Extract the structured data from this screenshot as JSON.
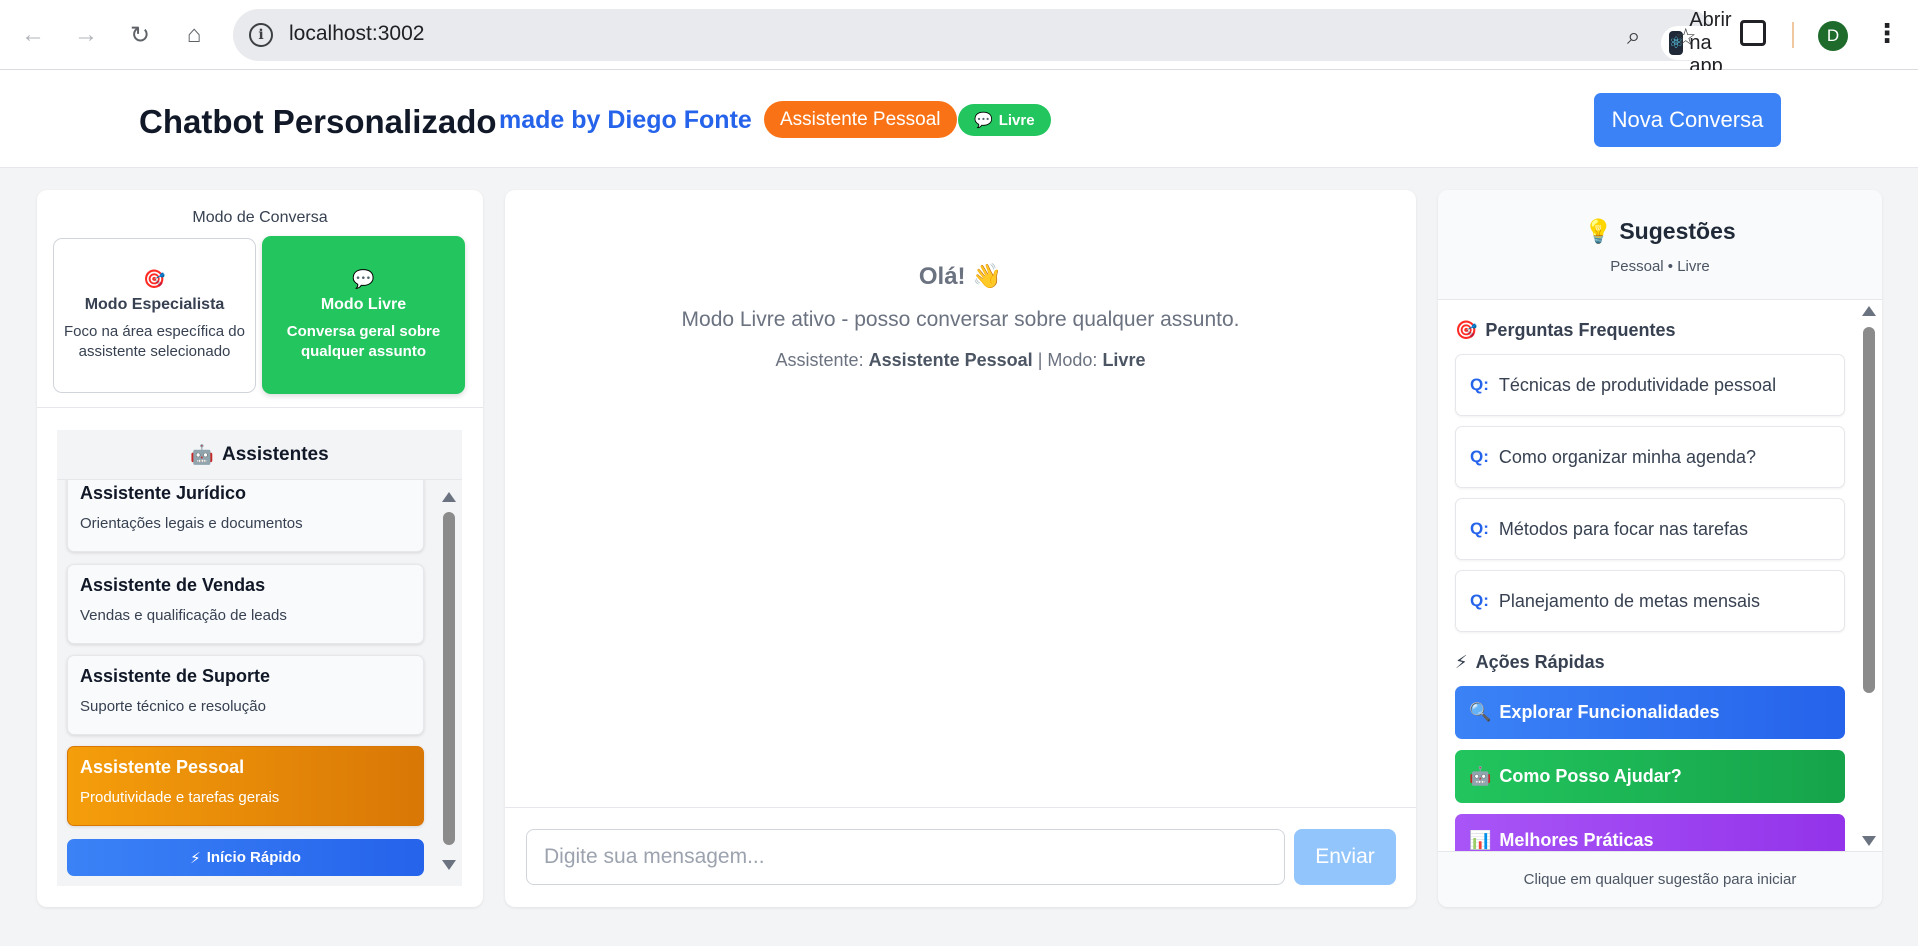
{
  "browser": {
    "url": "localhost:3002",
    "open_app_label": "Abrir na app",
    "profile_initial": "D"
  },
  "header": {
    "title": "Chatbot Personalizado",
    "made_by": "made by Diego Fonte",
    "assistant_badge": "Assistente Pessoal",
    "mode_badge": "Livre",
    "new_conversation": "Nova Conversa"
  },
  "mode": {
    "heading": "Modo de Conversa",
    "specialist": {
      "icon": "🎯",
      "title": "Modo Especialista",
      "desc": "Foco na área específica do assistente selecionado"
    },
    "free": {
      "icon": "💬",
      "title": "Modo Livre",
      "desc": "Conversa geral sobre qualquer assunto"
    }
  },
  "assistants": {
    "heading": "Assistentes",
    "icon": "🤖",
    "items": [
      {
        "title": "Assistente Jurídico",
        "desc": "Orientações legais e documentos"
      },
      {
        "title": "Assistente de Vendas",
        "desc": "Vendas e qualificação de leads"
      },
      {
        "title": "Assistente de Suporte",
        "desc": "Suporte técnico e resolução"
      },
      {
        "title": "Assistente Pessoal",
        "desc": "Produtividade e tarefas gerais"
      }
    ],
    "quick_start": "Início Rápido",
    "quick_start_icon": "⚡"
  },
  "chat": {
    "greeting": "Olá! 👋",
    "subtitle": "Modo Livre ativo - posso conversar sobre qualquer assunto.",
    "info_prefix": "Assistente:",
    "info_assistant": "Assistente Pessoal",
    "info_sep": "| Modo:",
    "info_mode": "Livre",
    "input_placeholder": "Digite sua mensagem...",
    "send": "Enviar"
  },
  "suggestions": {
    "icon": "💡",
    "title": "Sugestões",
    "subtitle": "Pessoal • Livre",
    "faq_icon": "🎯",
    "faq_title": "Perguntas Frequentes",
    "q_prefix": "Q:",
    "questions": [
      "Técnicas de produtividade pessoal",
      "Como organizar minha agenda?",
      "Métodos para focar nas tarefas",
      "Planejamento de metas mensais"
    ],
    "actions_icon": "⚡",
    "actions_title": "Ações Rápidas",
    "actions": [
      {
        "icon": "🔍",
        "label": "Explorar Funcionalidades"
      },
      {
        "icon": "🤖",
        "label": "Como Posso Ajudar?"
      },
      {
        "icon": "📊",
        "label": "Melhores Práticas"
      }
    ],
    "footer": "Clique em qualquer sugestão para iniciar"
  }
}
